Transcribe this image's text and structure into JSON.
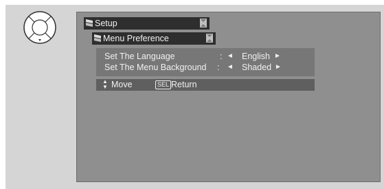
{
  "remote": {
    "icon": "dpad-icon"
  },
  "menu": {
    "title": "Setup",
    "submenu_title": "Menu Preference",
    "items": [
      {
        "label": "Set The Language",
        "value": "English"
      },
      {
        "label": "Set The Menu Background",
        "value": "Shaded"
      }
    ],
    "separator": ":",
    "left_arrow": "◄",
    "right_arrow": "►"
  },
  "hint": {
    "move_label": "Move",
    "sel_key": "SEL",
    "return_label": "Return"
  },
  "colors": {
    "frame": "#d5d5d5",
    "screen": "#8f8f8f",
    "title_bar": "#2e2e2e",
    "panel": "#777777",
    "hint_bar": "#5f5f5f"
  }
}
